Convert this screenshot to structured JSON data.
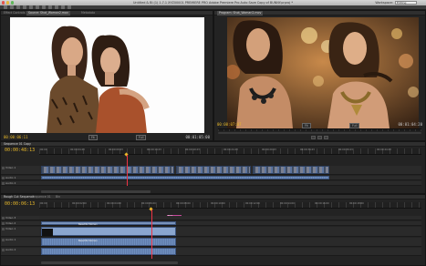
{
  "app": {
    "window_title": "Untitled & BI (1) 1.7.1 XYZ00001 PREMIERE PRO Adobe Premiere Pro Auto Save Copy of BUNNY.prproj *",
    "workspace_label": "Workspace:",
    "workspace_value": "Editing (CS5.5)"
  },
  "source_monitor": {
    "tabs": [
      "Effect Controls",
      "Source: Shot_Woman2.mov",
      "Metadata"
    ],
    "active_tab_index": 1,
    "timecode_in": "00:00:06:11",
    "timecode_dur": "00:01:05:00",
    "fit_label": "Fit",
    "fit_option": "Full"
  },
  "program_monitor": {
    "tabs": [
      "Program: Shot_Woman2.mov"
    ],
    "timecode_in": "00:00:07:07",
    "timecode_dur": "00:01:04:20",
    "fit_label": "Fit",
    "fit_option": "Full"
  },
  "timeline_upper": {
    "tab": "Sequence 01 Copy",
    "timecode": "00:00:48:13",
    "ticks": [
      "00:00",
      "00:00:04:23",
      "00:00:09:23",
      "00:00:14:23",
      "00:00:19:23",
      "00:00:24:23",
      "00:00:29:23",
      "00:00:34:23",
      "00:00:39:23",
      "00:00:44:23",
      "00:00:49:23"
    ],
    "tracks": [
      "Video 1",
      "Audio 1",
      "Audio 2"
    ]
  },
  "timeline_lower": {
    "tabs": [
      "Rough Cut Sequence",
      "Sequence 01",
      "Bin"
    ],
    "timecode": "00:00:06:13",
    "ticks": [
      "00:00",
      "00:00:02:00",
      "00:00:04:00",
      "00:00:06:00",
      "00:00:08:00",
      "00:00:10:00",
      "00:00:12:00",
      "00:00:14:00",
      "00:00:16:00",
      "00:00:18:00"
    ],
    "tracks": [
      "Video 3",
      "Video 2",
      "Video 1",
      "Audio 1",
      "Audio 2"
    ],
    "clip_labels": [
      "Beautiful Women",
      "Beautiful Women"
    ],
    "marker_label": "Bird"
  },
  "colors": {
    "timecode": "#e8b82a",
    "video_clip": "#5d7aa8",
    "audio_clip": "#6f8fbf",
    "playhead": "#e34"
  },
  "icons": [
    "close-icon",
    "minimize-icon",
    "zoom-icon",
    "selection-tool-icon",
    "razor-tool-icon",
    "play-icon",
    "step-back-icon",
    "step-forward-icon",
    "lock-icon",
    "eye-icon",
    "speaker-icon"
  ]
}
